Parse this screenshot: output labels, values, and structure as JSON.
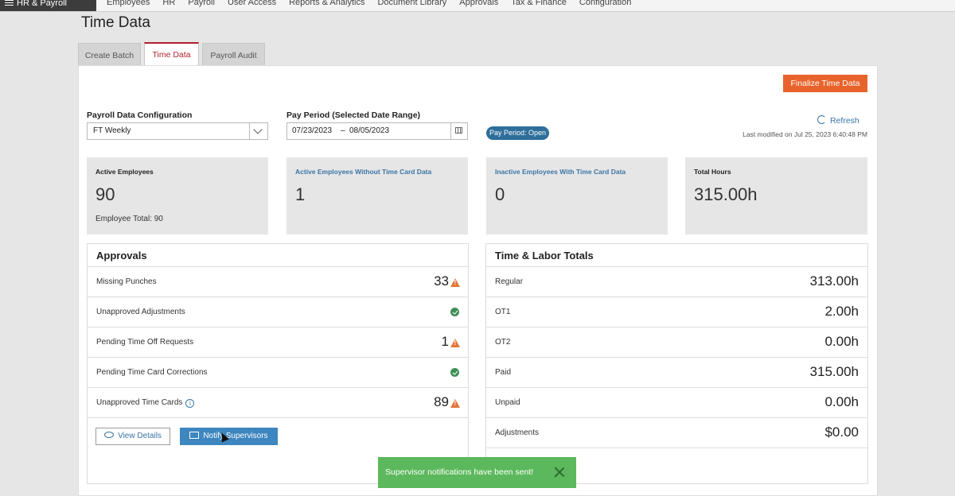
{
  "app": {
    "name": "HR & Payroll"
  },
  "nav": [
    "Employees",
    "HR",
    "Payroll",
    "User Access",
    "Reports & Analytics",
    "Document Library",
    "Approvals",
    "Tax & Finance",
    "Configuration"
  ],
  "page_title": "Time Data",
  "tabs": [
    "Create Batch",
    "Time Data",
    "Payroll Audit"
  ],
  "finalize_label": "Finalize Time Data",
  "config": {
    "label": "Payroll Data Configuration",
    "value": "FT Weekly"
  },
  "period": {
    "label": "Pay Period (Selected Date Range)",
    "start": "07/23/2023",
    "sep": "–",
    "end": "08/05/2023"
  },
  "status_pill": "Pay Period: Open",
  "refresh_label": "Refresh",
  "last_modified": "Last modified on Jul 25, 2023 6:40:48 PM",
  "cards": {
    "active": {
      "title": "Active Employees",
      "value": "90",
      "sub": "Employee Total: 90"
    },
    "without": {
      "title": "Active Employees Without Time Card Data",
      "value": "1"
    },
    "inactive": {
      "title": "Inactive Employees With Time Card Data",
      "value": "0"
    },
    "hours": {
      "title": "Total Hours",
      "value": "315.00h"
    }
  },
  "approvals": {
    "title": "Approvals",
    "rows": [
      {
        "label": "Missing Punches",
        "value": "33"
      },
      {
        "label": "Unapproved Adjustments",
        "value": ""
      },
      {
        "label": "Pending Time Off Requests",
        "value": "1"
      },
      {
        "label": "Pending Time Card Corrections",
        "value": ""
      },
      {
        "label": "Unapproved Time Cards",
        "value": "89"
      }
    ],
    "view_details": "View Details",
    "notify": "Notify Supervisors"
  },
  "labor": {
    "title": "Time & Labor Totals",
    "rows": [
      {
        "label": "Regular",
        "value": "313.00h"
      },
      {
        "label": "OT1",
        "value": "2.00h"
      },
      {
        "label": "OT2",
        "value": "0.00h"
      },
      {
        "label": "Paid",
        "value": "315.00h"
      },
      {
        "label": "Unpaid",
        "value": "0.00h"
      },
      {
        "label": "Adjustments",
        "value": "$0.00"
      }
    ]
  },
  "toast": "Supervisor notifications have been sent!",
  "colors": {
    "accent": "#e8632b",
    "active_tab": "#b0212d",
    "link": "#3a75a6",
    "success": "#5cb85c"
  }
}
